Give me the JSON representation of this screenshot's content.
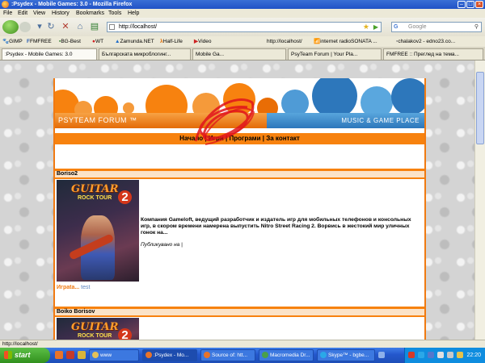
{
  "window": {
    "title": ":Psydex - Mobile Games: 3.0 - Mozilla Firefox"
  },
  "menu": {
    "items": [
      "File",
      "Edit",
      "View",
      "History",
      "Bookmarks",
      "Tools",
      "Help"
    ]
  },
  "address_bar": {
    "url": "http://localhost/"
  },
  "search": {
    "engine_label": "G",
    "placeholder": "Google"
  },
  "bookmarks": {
    "items": [
      "GIMP",
      "FMFREE",
      "BG-Best",
      "WT",
      "Zamunda.NET",
      "Half-Life",
      "Video",
      "http://localhost/",
      "internet radioSONATA ...",
      "chalakov2 - edno23.co..."
    ]
  },
  "tabs": {
    "items": [
      ":Psydex - Mobile Games: 3.0",
      "Българската микроблогинг...",
      "Mobile Ga...",
      "PsyTeam Forum | Your Pla...",
      "FMFREE :: Преглед на тема..."
    ]
  },
  "banner": {
    "left_title": "PSYTEAM FORUM ™",
    "right_title": "MUSIC & GAME PLACE"
  },
  "nav": {
    "items": [
      "Начало",
      "Игри",
      "Програми",
      "За контакт"
    ],
    "separator": "|"
  },
  "posts": [
    {
      "author": "Boriso2",
      "image_title_1": "GUITAR",
      "image_title_2": "ROCK TOUR",
      "image_title_3": "2",
      "body": "Компания Gameloft, ведущий разработчик и издатель игр для мобильных телефонов и консольных игр, в скором времени намерена выпустить Nitro Street Racing 2. Ворвись в жестокий мир уличных гонок на...",
      "published": "Публикувано на |",
      "category": "Игрata...",
      "tag": "test"
    },
    {
      "author": "Boiko Borisov",
      "image_title_1": "GUITAR",
      "image_title_2": "ROCK TOUR",
      "image_title_3": "2"
    }
  ],
  "status": {
    "text": "http://localhost/"
  },
  "taskbar": {
    "start_label": "start",
    "tasks": [
      "www",
      ":Psydex - Mo...",
      "Source of: htt...",
      "Macromedia Dr...",
      "Skype™ - bgbe..."
    ],
    "clock": "22:20"
  },
  "colors": {
    "accent_orange": "#f7820f",
    "banner_blue": "#2d77bb",
    "category_link": "#ef7a12",
    "tag_link": "#5b84bf"
  }
}
